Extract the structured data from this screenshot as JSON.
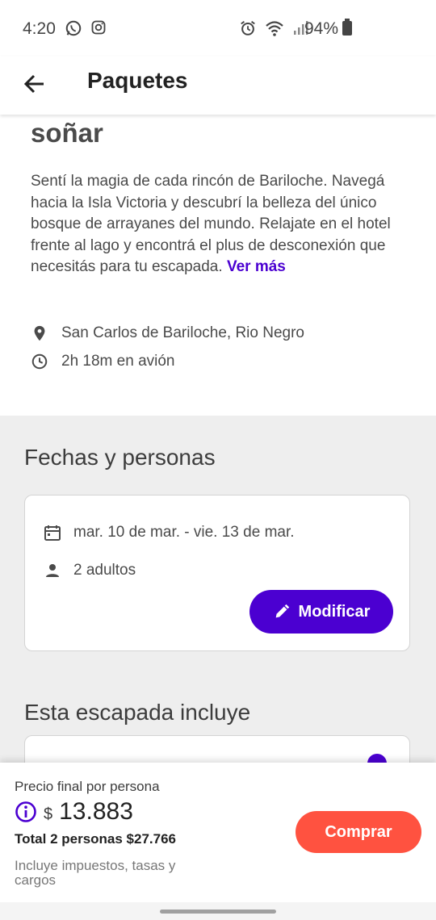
{
  "status_bar": {
    "time": "4:20",
    "battery": "94%",
    "icons": [
      "whatsapp-icon",
      "instagram-icon",
      "alarm-icon",
      "wifi-icon",
      "signal-icon",
      "battery-icon"
    ]
  },
  "app_bar": {
    "title": "Paquetes"
  },
  "hero": {
    "title_fragment": "soñar",
    "description": "Sentí la magia de cada rincón de Bariloche. Navegá hacia la Isla Victoria y descubrí la belleza del único bosque de arrayanes del mundo. Relajate en el hotel frente al lago y encontrá el plus de desconexión que necesitás para tu escapada.",
    "see_more": "Ver más",
    "location": "San Carlos de Bariloche, Rio Negro",
    "travel_time": "2h 18m en avión"
  },
  "dates_section": {
    "title": "Fechas y personas",
    "dates": "mar. 10 de mar. - vie. 13 de mar.",
    "people": "2 adultos",
    "modify_label": "Modificar"
  },
  "includes_section": {
    "title": "Esta escapada incluye"
  },
  "bottom_bar": {
    "price_label": "Precio final por persona",
    "currency": "$",
    "price": "13.883",
    "total": "Total 2 personas $27.766",
    "taxes_note": "Incluye impuestos, tasas y cargos",
    "buy_label": "Comprar"
  },
  "colors": {
    "accent": "#4b00d1",
    "buy": "#ff5240",
    "grey_bg": "#eeeeee"
  }
}
